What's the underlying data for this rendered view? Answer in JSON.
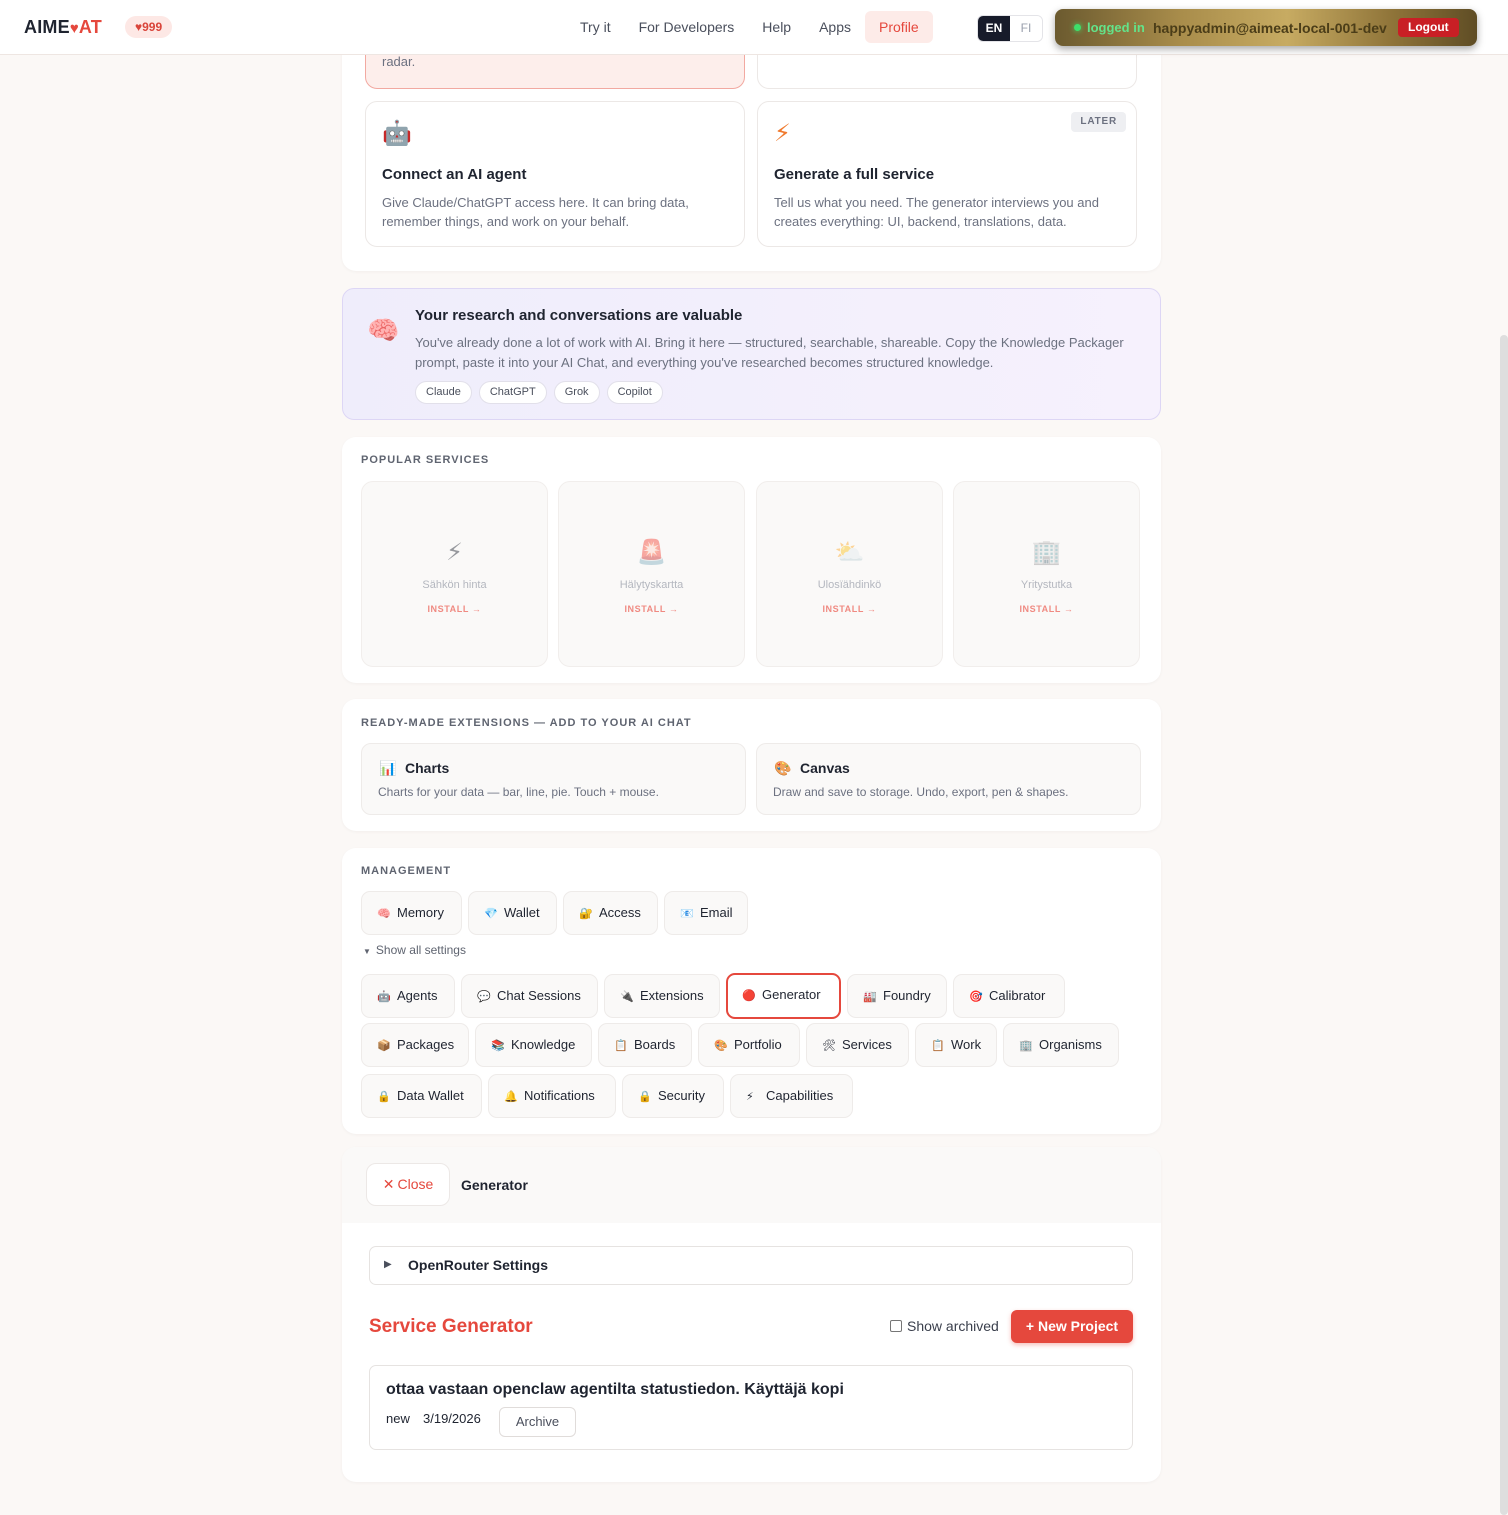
{
  "nav": {
    "logo_left": "AIME",
    "logo_heart": "♥",
    "logo_right": "AT",
    "credits": "♥999",
    "links": [
      "Try it",
      "For Developers",
      "Help",
      "Apps",
      "Profile"
    ],
    "lang_en": "EN",
    "lang_fi": "FI",
    "session_status": "logged in",
    "session_user": "happyadmin@aimeat-local-001-dev",
    "logout": "Logout"
  },
  "top_cards": {
    "partial_text": "radar.",
    "agent": {
      "icon": "🤖",
      "title": "Connect an AI agent",
      "desc": "Give Claude/ChatGPT access here. It can bring data, remember things, and work on your behalf."
    },
    "generate": {
      "icon": "⚡",
      "badge": "LATER",
      "title": "Generate a full service",
      "desc": "Tell us what you need. The generator interviews you and creates everything: UI, backend, translations, data."
    }
  },
  "knowledge_banner": {
    "icon": "🧠",
    "title": "Your research and conversations are valuable",
    "desc": "You've already done a lot of work with AI. Bring it here — structured, searchable, shareable. Copy the Knowledge Packager prompt, paste it into your AI Chat, and everything you've researched becomes structured knowledge.",
    "tags": [
      "Claude",
      "ChatGPT",
      "Grok",
      "Copilot"
    ]
  },
  "popular": {
    "label": "POPULAR SERVICES",
    "install": "INSTALL →",
    "items": [
      {
        "icon": "⚡",
        "name": "Sähkön hinta"
      },
      {
        "icon": "🚨",
        "name": "Hälytyskartta"
      },
      {
        "icon": "⛅",
        "name": "Ulosïähdinkö"
      },
      {
        "icon": "🏢",
        "name": "Yritystutka"
      }
    ]
  },
  "extensions": {
    "label": "READY-MADE EXTENSIONS — ADD TO YOUR AI CHAT",
    "items": [
      {
        "icon": "📊",
        "name": "Charts",
        "desc": "Charts for your data — bar, line, pie. Touch + mouse."
      },
      {
        "icon": "🎨",
        "name": "Canvas",
        "desc": "Draw and save to storage. Undo, export, pen & shapes."
      }
    ]
  },
  "management": {
    "label": "MANAGEMENT",
    "primary": [
      {
        "icon": "🧠",
        "label": "Memory"
      },
      {
        "icon": "💎",
        "label": "Wallet"
      },
      {
        "icon": "🔐",
        "label": "Access"
      },
      {
        "icon": "📧",
        "label": "Email"
      }
    ],
    "show_all": "Show all settings",
    "settings": [
      {
        "icon": "🤖",
        "label": "Agents"
      },
      {
        "icon": "💬",
        "label": "Chat Sessions"
      },
      {
        "icon": "🔌",
        "label": "Extensions"
      },
      {
        "icon": "🔴",
        "label": "Generator"
      },
      {
        "icon": "🏭",
        "label": "Foundry"
      },
      {
        "icon": "🎯",
        "label": "Calibrator"
      },
      {
        "icon": "📦",
        "label": "Packages"
      },
      {
        "icon": "📚",
        "label": "Knowledge"
      },
      {
        "icon": "📋",
        "label": "Boards"
      },
      {
        "icon": "🎨",
        "label": "Portfolio"
      },
      {
        "icon": "🛠",
        "label": "Services"
      },
      {
        "icon": "📋",
        "label": "Work"
      },
      {
        "icon": "🏢",
        "label": "Organisms"
      },
      {
        "icon": "🔒",
        "label": "Data Wallet"
      },
      {
        "icon": "🔔",
        "label": "Notifications"
      },
      {
        "icon": "🔒",
        "label": "Security"
      },
      {
        "icon": "⚡",
        "label": "Capabilities"
      }
    ]
  },
  "generator_panel": {
    "close": "Close",
    "close_icon": "✕",
    "title": "Generator",
    "openrouter": "OpenRouter Settings",
    "heading": "Service Generator",
    "show_archived": "Show archived",
    "new_project": "+ New Project",
    "project": {
      "title": "ottaa vastaan openclaw agentilta statustiedon. Käyttäjä kopi",
      "status": "new",
      "date": "3/19/2026",
      "archive": "Archive"
    }
  },
  "colors": {
    "accent": "#e5483d",
    "dark": "#171b2a",
    "banner_bg": "#f3f0fd"
  }
}
